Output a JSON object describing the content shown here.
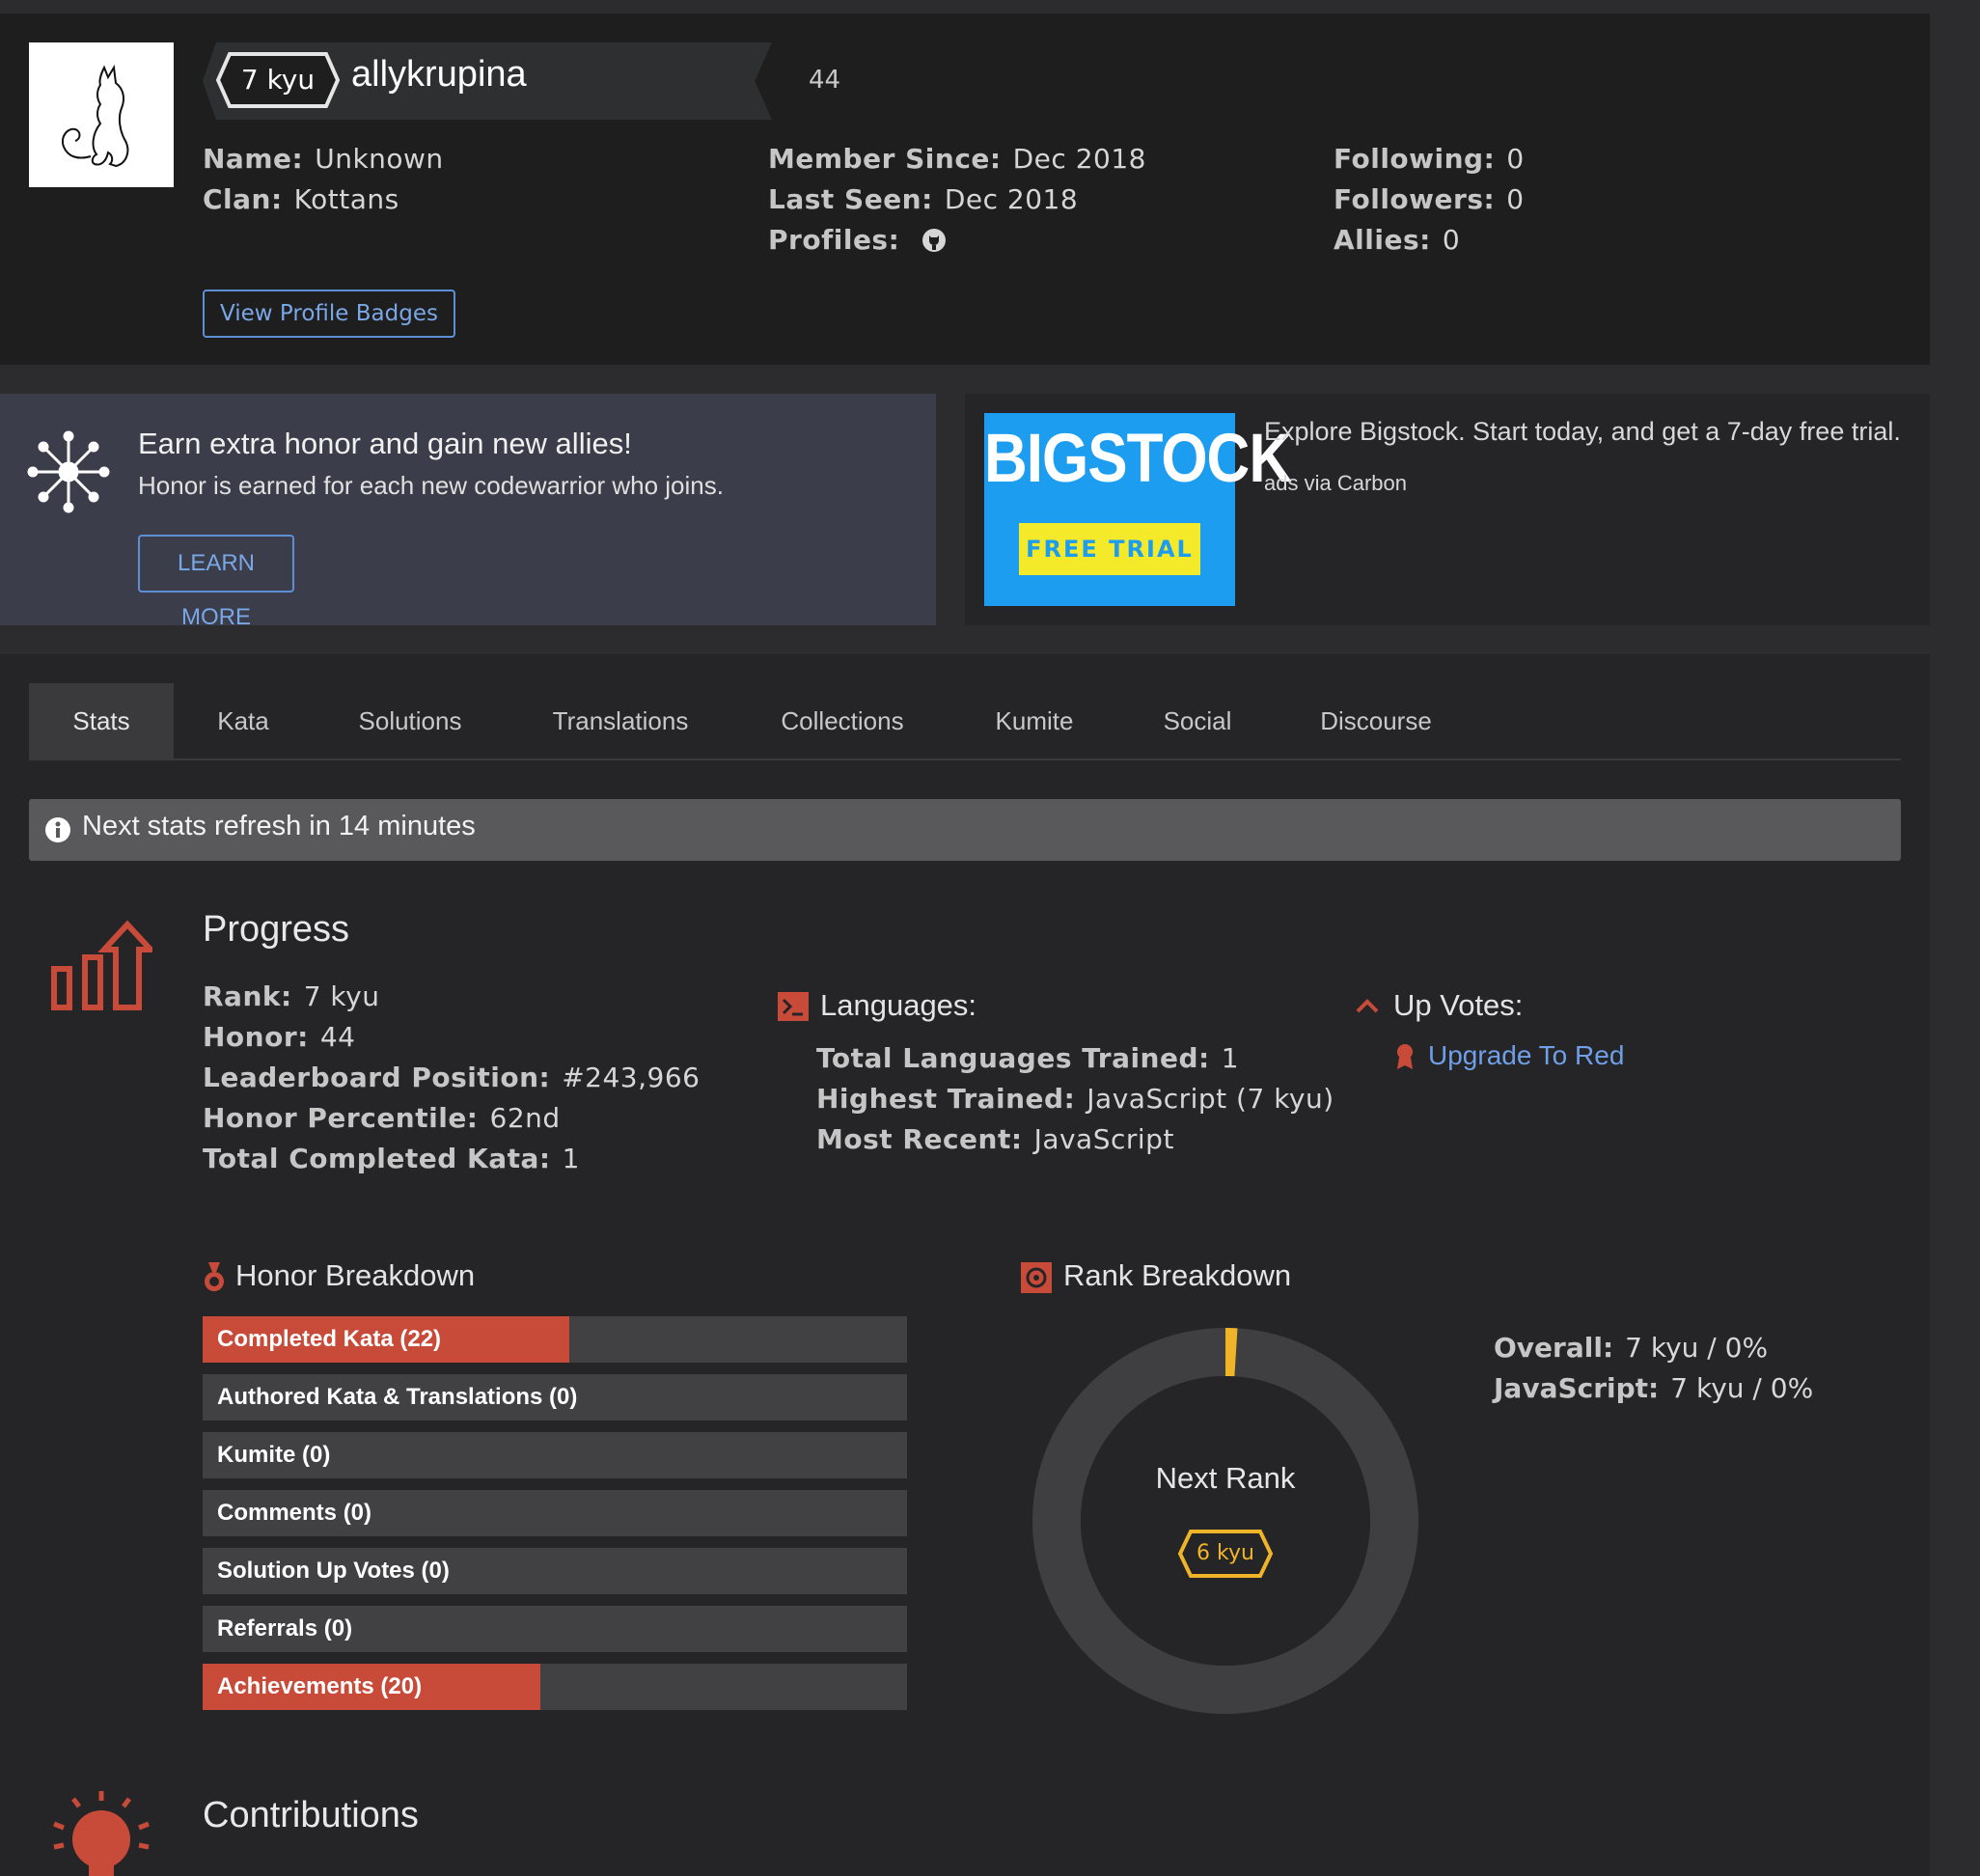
{
  "profile": {
    "rank": "7 kyu",
    "username": "allykrupina",
    "honor": "44",
    "name_label": "Name:",
    "name_value": "Unknown",
    "clan_label": "Clan:",
    "clan_value": "Kottans",
    "member_since_label": "Member Since:",
    "member_since_value": "Dec 2018",
    "last_seen_label": "Last Seen:",
    "last_seen_value": "Dec 2018",
    "profiles_label": "Profiles:",
    "following_label": "Following:",
    "following_value": "0",
    "followers_label": "Followers:",
    "followers_value": "0",
    "allies_label": "Allies:",
    "allies_value": "0",
    "badges_button": "View Profile Badges"
  },
  "promo": {
    "title": "Earn extra honor and gain new allies!",
    "subtitle": "Honor is earned for each new codewarrior who joins.",
    "button": "LEARN MORE"
  },
  "ad": {
    "logo": "BIGSTOCK",
    "trial": "FREE TRIAL",
    "text": "Explore Bigstock. Start today, and get a 7-day free trial.",
    "via": "ads via Carbon",
    "brand_color": "#1d9df0"
  },
  "tabs": [
    {
      "label": "Stats",
      "active": true
    },
    {
      "label": "Kata"
    },
    {
      "label": "Solutions"
    },
    {
      "label": "Translations"
    },
    {
      "label": "Collections"
    },
    {
      "label": "Kumite"
    },
    {
      "label": "Social"
    },
    {
      "label": "Discourse"
    }
  ],
  "notice": "Next stats refresh in 14 minutes",
  "progress": {
    "title": "Progress",
    "rank_label": "Rank:",
    "rank_value": "7 kyu",
    "honor_label": "Honor:",
    "honor_value": "44",
    "leaderboard_label": "Leaderboard Position:",
    "leaderboard_value": "#243,966",
    "percentile_label": "Honor Percentile:",
    "percentile_value": "62nd",
    "completed_label": "Total Completed Kata:",
    "completed_value": "1"
  },
  "languages": {
    "title": "Languages:",
    "total_label": "Total Languages Trained:",
    "total_value": "1",
    "highest_label": "Highest Trained:",
    "highest_value": "JavaScript (7 kyu)",
    "recent_label": "Most Recent:",
    "recent_value": "JavaScript"
  },
  "upvotes": {
    "title": "Up Votes:",
    "link": "Upgrade To Red"
  },
  "honor_breakdown": {
    "title": "Honor Breakdown",
    "bars": [
      {
        "label": "Completed Kata (22)",
        "fill": 0.52
      },
      {
        "label": "Authored Kata & Translations (0)",
        "fill": 0
      },
      {
        "label": "Kumite (0)",
        "fill": 0
      },
      {
        "label": "Comments (0)",
        "fill": 0
      },
      {
        "label": "Solution Up Votes (0)",
        "fill": 0
      },
      {
        "label": "Referrals (0)",
        "fill": 0
      },
      {
        "label": "Achievements (20)",
        "fill": 0.48
      }
    ],
    "accent": "#c84b3a"
  },
  "rank_breakdown": {
    "title": "Rank Breakdown",
    "next_rank_label": "Next Rank",
    "next_rank": "6 kyu",
    "progress_fraction": 0.01,
    "overall_label": "Overall:",
    "overall_value": "7 kyu / 0%",
    "js_label": "JavaScript:",
    "js_value": "7 kyu / 0%",
    "accent": "#f0b429"
  },
  "contributions": {
    "title": "Contributions"
  }
}
